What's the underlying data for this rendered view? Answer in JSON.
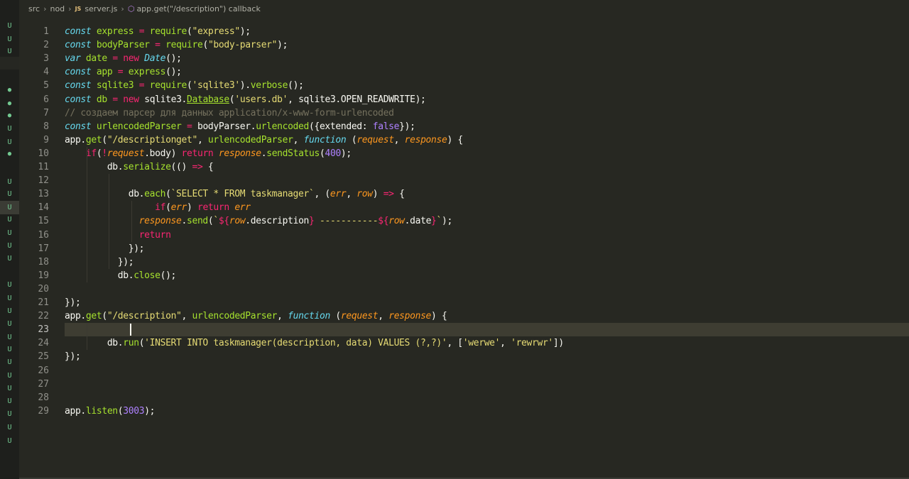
{
  "breadcrumb": {
    "segments": [
      "src",
      "nod",
      "server.js",
      "app.get(\"/description\") callback"
    ],
    "file_icon_text": "JS"
  },
  "gutter_markers": [
    "U",
    "U",
    "U",
    "",
    "",
    "●",
    "●",
    "●",
    "U",
    "U",
    "●",
    "",
    "U",
    "U",
    "U",
    "U",
    "U",
    "U",
    "U",
    "",
    "U",
    "U",
    "U",
    "U",
    "U",
    "U",
    "U",
    "U",
    "U",
    "U",
    "U",
    "U",
    "U",
    "U"
  ],
  "editor": {
    "current_line": 23,
    "lines": [
      {
        "n": "1",
        "code": "const express = require(\"express\");"
      },
      {
        "n": "2",
        "code": "const bodyParser = require(\"body-parser\");"
      },
      {
        "n": "3",
        "code": "var date = new Date();"
      },
      {
        "n": "4",
        "code": "const app = express();"
      },
      {
        "n": "5",
        "code": "const sqlite3 = require('sqlite3').verbose();"
      },
      {
        "n": "6",
        "code": "const db = new sqlite3.Database('users.db', sqlite3.OPEN_READWRITE);"
      },
      {
        "n": "7",
        "code": "// создаем парсер для данных application/x-www-form-urlencoded"
      },
      {
        "n": "8",
        "code": "const urlencodedParser = bodyParser.urlencoded({extended: false});"
      },
      {
        "n": "9",
        "code": "app.get(\"/descriptionget\", urlencodedParser, function (request, response) {"
      },
      {
        "n": "10",
        "code": "    if(!request.body) return response.sendStatus(400);"
      },
      {
        "n": "11",
        "code": "        db.serialize(() => {"
      },
      {
        "n": "12",
        "code": ""
      },
      {
        "n": "13",
        "code": "            db.each(`SELECT * FROM taskmanager`, (err, row) => {"
      },
      {
        "n": "14",
        "code": "                 if(err) return err"
      },
      {
        "n": "15",
        "code": "              response.send(`${row.description} -----------${row.date}`);"
      },
      {
        "n": "16",
        "code": "              return"
      },
      {
        "n": "17",
        "code": "            });"
      },
      {
        "n": "18",
        "code": "          });"
      },
      {
        "n": "19",
        "code": "          db.close();"
      },
      {
        "n": "20",
        "code": ""
      },
      {
        "n": "21",
        "code": "});"
      },
      {
        "n": "22",
        "code": "app.get(\"/description\", urlencodedParser, function (request, response) {"
      },
      {
        "n": "23",
        "code": ""
      },
      {
        "n": "24",
        "code": "        db.run('INSERT INTO taskmanager(description, data) VALUES (?,?)', ['werwe', 'rewrwr'])"
      },
      {
        "n": "25",
        "code": "});"
      },
      {
        "n": "26",
        "code": ""
      },
      {
        "n": "27",
        "code": ""
      },
      {
        "n": "28",
        "code": ""
      },
      {
        "n": "29",
        "code": "app.listen(3003);"
      }
    ]
  },
  "colors": {
    "background": "#272822",
    "keyword": "#66d9ef",
    "function": "#a6e22e",
    "string": "#e6db74",
    "operator": "#f92672",
    "number": "#ae81ff",
    "param": "#fd971f",
    "comment": "#75715e"
  }
}
